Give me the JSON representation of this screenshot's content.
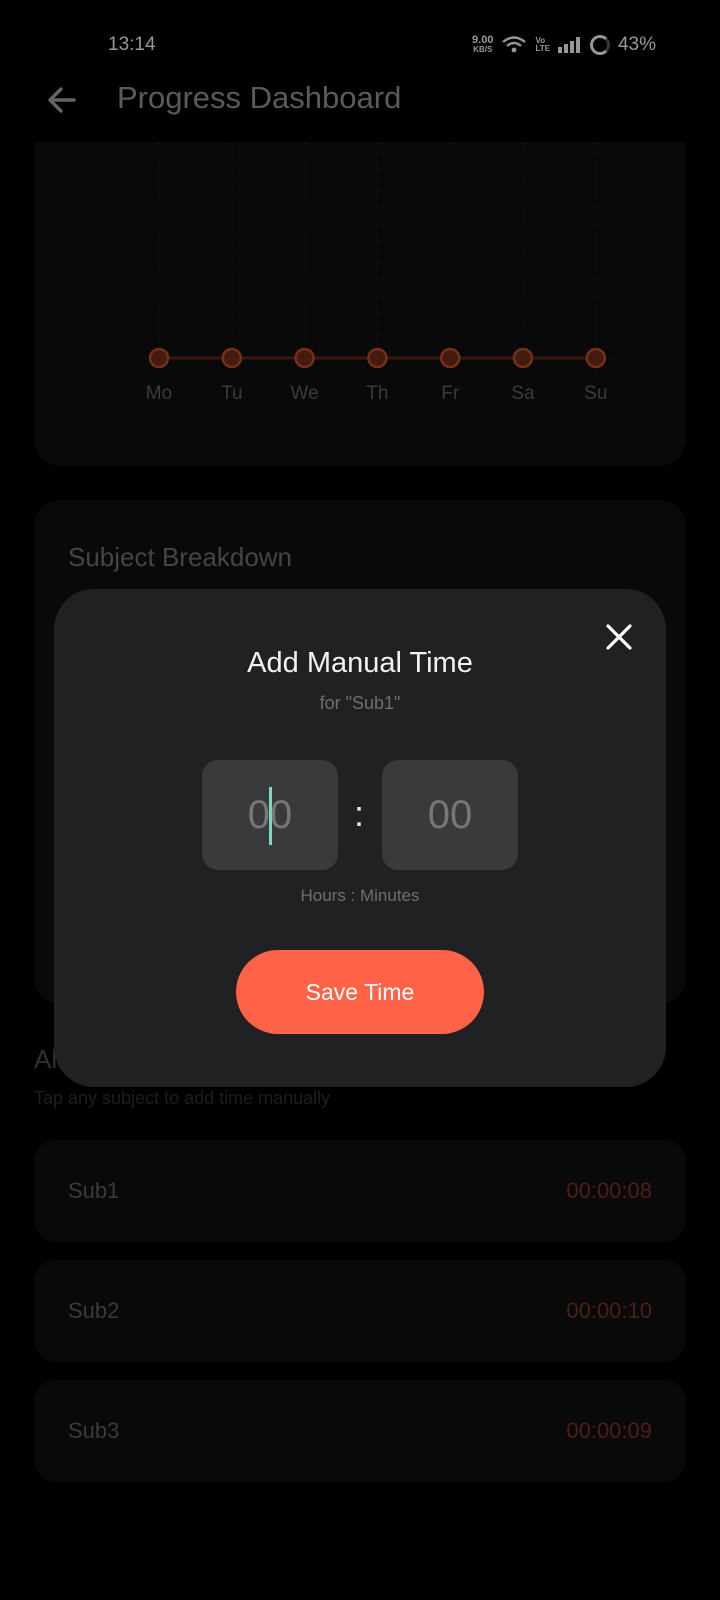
{
  "status_bar": {
    "time": "13:14",
    "net_speed_value": "9.00",
    "net_speed_unit": "KB/S",
    "volte_top": "Vo",
    "volte_bottom": "LTE",
    "battery": "43%"
  },
  "header": {
    "title": "Progress Dashboard",
    "back_icon": "arrow-left-icon"
  },
  "weekly_chart": {
    "chart_data": {
      "type": "line",
      "categories": [
        "Mo",
        "Tu",
        "We",
        "Th",
        "Fr",
        "Sa",
        "Su"
      ],
      "series": [
        {
          "values": [
            0,
            0,
            0,
            0,
            0,
            0,
            0
          ]
        }
      ],
      "grid": "vertical dashed",
      "color": "#b24a2a"
    }
  },
  "breakdown": {
    "title": "Subject Breakdown"
  },
  "all_subjects": {
    "title": "All Subjects",
    "subtitle": "Tap any subject to add time manually",
    "items": [
      {
        "name": "Sub1",
        "time": "00:00:08"
      },
      {
        "name": "Sub2",
        "time": "00:00:10"
      },
      {
        "name": "Sub3",
        "time": "00:00:09"
      }
    ]
  },
  "modal": {
    "title": "Add Manual Time",
    "subtitle": "for \"Sub1\"",
    "hours_placeholder": "00",
    "minutes_placeholder": "00",
    "separator": ":",
    "caption": "Hours : Minutes",
    "save_label": "Save Time",
    "close_icon": "close-icon"
  },
  "colors": {
    "accent": "#ff6347",
    "background": "#000000",
    "card": "#0f0f0f",
    "modal": "#212124",
    "input": "#3a3a3d",
    "caret": "#7fd6c3"
  }
}
